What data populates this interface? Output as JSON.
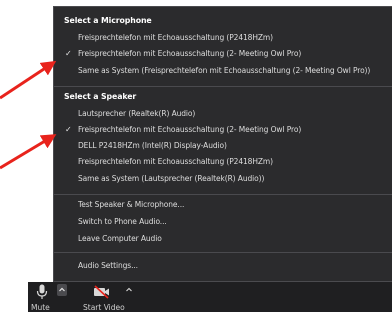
{
  "microphone": {
    "header": "Select a Microphone",
    "items": [
      {
        "label": "Freisprechtelefon mit Echoausschaltung (P2418HZm)",
        "checked": false
      },
      {
        "label": "Freisprechtelefon mit Echoausschaltung (2- Meeting Owl Pro)",
        "checked": true
      },
      {
        "label": "Same as System (Freisprechtelefon mit Echoausschaltung (2- Meeting Owl Pro))",
        "checked": false
      }
    ]
  },
  "speaker": {
    "header": "Select a Speaker",
    "items": [
      {
        "label": "Lautsprecher (Realtek(R) Audio)",
        "checked": false
      },
      {
        "label": "Freisprechtelefon mit Echoausschaltung (2- Meeting Owl Pro)",
        "checked": true
      },
      {
        "label": "DELL P2418HZm (Intel(R) Display-Audio)",
        "checked": false
      },
      {
        "label": "Freisprechtelefon mit Echoausschaltung (P2418HZm)",
        "checked": false
      },
      {
        "label": "Same as System (Lautsprecher (Realtek(R) Audio))",
        "checked": false
      }
    ]
  },
  "actions": [
    {
      "label": "Test Speaker & Microphone..."
    },
    {
      "label": "Switch to Phone Audio..."
    },
    {
      "label": "Leave Computer Audio"
    }
  ],
  "settings": {
    "label": "Audio Settings..."
  },
  "toolbar": {
    "mute_label": "Mute",
    "video_label": "Start Video"
  },
  "check_glyph": "✓",
  "colors": {
    "menu_bg": "#2b2b2d",
    "toolbar_bg": "#1f1f21",
    "arrow": "#e8231c"
  }
}
